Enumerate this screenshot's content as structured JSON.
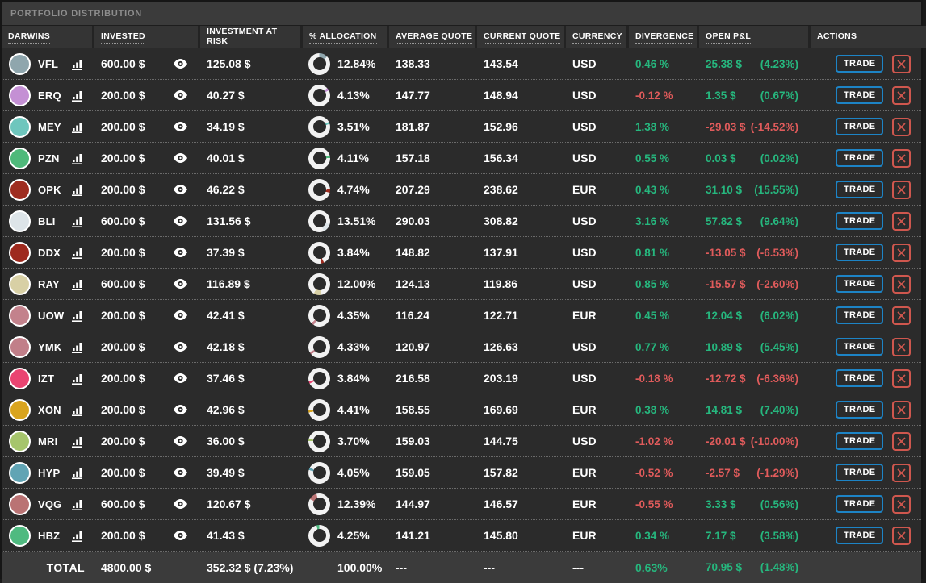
{
  "title": "PORTFOLIO DISTRIBUTION",
  "columns": [
    "DARWINS",
    "INVESTED",
    "INVESTMENT AT RISK",
    "% ALLOCATION",
    "AVERAGE QUOTE",
    "CURRENT QUOTE",
    "CURRENCY",
    "DIVERGENCE",
    "OPEN P&L",
    "ACTIONS"
  ],
  "actions": {
    "trade_label": "TRADE",
    "close_icon": "x-icon"
  },
  "colors": {
    "green": "#26b77e",
    "red": "#e05b5b",
    "trade_border_blue": "#1d84c6",
    "close_border_red": "#cf574e",
    "donut_ring": "#f2f2f2",
    "row_bg": "#2b2b2b",
    "header_bg": "#343434",
    "titlebar_bg": "#3b3b3b",
    "total_bg": "#3b3b3b"
  },
  "rows": [
    {
      "name": "VFL",
      "color": "#8fa6ad",
      "invested": "600.00 $",
      "at_risk": "125.08 $",
      "allocation_pct": 12.84,
      "allocation": "12.84%",
      "avg_quote": "138.33",
      "current_quote": "143.54",
      "currency": "USD",
      "divergence": "0.46 %",
      "divergence_state": "pos",
      "pnl": "25.38 $",
      "pnl_pct": "(4.23%)",
      "pnl_state": "pos"
    },
    {
      "name": "ERQ",
      "color": "#c490d4",
      "invested": "200.00 $",
      "at_risk": "40.27 $",
      "allocation_pct": 4.13,
      "allocation": "4.13%",
      "avg_quote": "147.77",
      "current_quote": "148.94",
      "currency": "USD",
      "divergence": "-0.12 %",
      "divergence_state": "neg",
      "pnl": "1.35 $",
      "pnl_pct": "(0.67%)",
      "pnl_state": "pos"
    },
    {
      "name": "MEY",
      "color": "#6ec6bd",
      "invested": "200.00 $",
      "at_risk": "34.19 $",
      "allocation_pct": 3.51,
      "allocation": "3.51%",
      "avg_quote": "181.87",
      "current_quote": "152.96",
      "currency": "USD",
      "divergence": "1.38 %",
      "divergence_state": "pos",
      "pnl": "-29.03 $",
      "pnl_pct": "(-14.52%)",
      "pnl_state": "neg"
    },
    {
      "name": "PZN",
      "color": "#4eb97a",
      "invested": "200.00 $",
      "at_risk": "40.01 $",
      "allocation_pct": 4.11,
      "allocation": "4.11%",
      "avg_quote": "157.18",
      "current_quote": "156.34",
      "currency": "USD",
      "divergence": "0.55 %",
      "divergence_state": "pos",
      "pnl": "0.03 $",
      "pnl_pct": "(0.02%)",
      "pnl_state": "pos"
    },
    {
      "name": "OPK",
      "color": "#9e2d20",
      "invested": "200.00 $",
      "at_risk": "46.22 $",
      "allocation_pct": 4.74,
      "allocation": "4.74%",
      "avg_quote": "207.29",
      "current_quote": "238.62",
      "currency": "EUR",
      "divergence": "0.43 %",
      "divergence_state": "pos",
      "pnl": "31.10 $",
      "pnl_pct": "(15.55%)",
      "pnl_state": "pos"
    },
    {
      "name": "BLI",
      "color": "#dde4e8",
      "invested": "600.00 $",
      "at_risk": "131.56 $",
      "allocation_pct": 13.51,
      "allocation": "13.51%",
      "avg_quote": "290.03",
      "current_quote": "308.82",
      "currency": "USD",
      "divergence": "3.16 %",
      "divergence_state": "pos",
      "pnl": "57.82 $",
      "pnl_pct": "(9.64%)",
      "pnl_state": "pos"
    },
    {
      "name": "DDX",
      "color": "#9e2a1e",
      "invested": "200.00 $",
      "at_risk": "37.39 $",
      "allocation_pct": 3.84,
      "allocation": "3.84%",
      "avg_quote": "148.82",
      "current_quote": "137.91",
      "currency": "USD",
      "divergence": "0.81 %",
      "divergence_state": "pos",
      "pnl": "-13.05 $",
      "pnl_pct": "(-6.53%)",
      "pnl_state": "neg"
    },
    {
      "name": "RAY",
      "color": "#d8d0a5",
      "invested": "600.00 $",
      "at_risk": "116.89 $",
      "allocation_pct": 12.0,
      "allocation": "12.00%",
      "avg_quote": "124.13",
      "current_quote": "119.86",
      "currency": "USD",
      "divergence": "0.85 %",
      "divergence_state": "pos",
      "pnl": "-15.57 $",
      "pnl_pct": "(-2.60%)",
      "pnl_state": "neg"
    },
    {
      "name": "UOW",
      "color": "#c3828c",
      "invested": "200.00 $",
      "at_risk": "42.41 $",
      "allocation_pct": 4.35,
      "allocation": "4.35%",
      "avg_quote": "116.24",
      "current_quote": "122.71",
      "currency": "EUR",
      "divergence": "0.45 %",
      "divergence_state": "pos",
      "pnl": "12.04 $",
      "pnl_pct": "(6.02%)",
      "pnl_state": "pos"
    },
    {
      "name": "YMK",
      "color": "#c17f89",
      "invested": "200.00 $",
      "at_risk": "42.18 $",
      "allocation_pct": 4.33,
      "allocation": "4.33%",
      "avg_quote": "120.97",
      "current_quote": "126.63",
      "currency": "USD",
      "divergence": "0.77 %",
      "divergence_state": "pos",
      "pnl": "10.89 $",
      "pnl_pct": "(5.45%)",
      "pnl_state": "pos"
    },
    {
      "name": "IZT",
      "color": "#ea4471",
      "invested": "200.00 $",
      "at_risk": "37.46 $",
      "allocation_pct": 3.84,
      "allocation": "3.84%",
      "avg_quote": "216.58",
      "current_quote": "203.19",
      "currency": "USD",
      "divergence": "-0.18 %",
      "divergence_state": "neg",
      "pnl": "-12.72 $",
      "pnl_pct": "(-6.36%)",
      "pnl_state": "neg"
    },
    {
      "name": "XON",
      "color": "#d9a41f",
      "invested": "200.00 $",
      "at_risk": "42.96 $",
      "allocation_pct": 4.41,
      "allocation": "4.41%",
      "avg_quote": "158.55",
      "current_quote": "169.69",
      "currency": "EUR",
      "divergence": "0.38 %",
      "divergence_state": "pos",
      "pnl": "14.81 $",
      "pnl_pct": "(7.40%)",
      "pnl_state": "pos"
    },
    {
      "name": "MRI",
      "color": "#a6c56c",
      "invested": "200.00 $",
      "at_risk": "36.00 $",
      "allocation_pct": 3.7,
      "allocation": "3.70%",
      "avg_quote": "159.03",
      "current_quote": "144.75",
      "currency": "USD",
      "divergence": "-1.02 %",
      "divergence_state": "neg",
      "pnl": "-20.01 $",
      "pnl_pct": "(-10.00%)",
      "pnl_state": "neg"
    },
    {
      "name": "HYP",
      "color": "#61a4b4",
      "invested": "200.00 $",
      "at_risk": "39.49 $",
      "allocation_pct": 4.05,
      "allocation": "4.05%",
      "avg_quote": "159.05",
      "current_quote": "157.82",
      "currency": "EUR",
      "divergence": "-0.52 %",
      "divergence_state": "neg",
      "pnl": "-2.57 $",
      "pnl_pct": "(-1.29%)",
      "pnl_state": "neg"
    },
    {
      "name": "VQG",
      "color": "#ba7374",
      "invested": "600.00 $",
      "at_risk": "120.67 $",
      "allocation_pct": 12.39,
      "allocation": "12.39%",
      "avg_quote": "144.97",
      "current_quote": "146.57",
      "currency": "EUR",
      "divergence": "-0.55 %",
      "divergence_state": "neg",
      "pnl": "3.33 $",
      "pnl_pct": "(0.56%)",
      "pnl_state": "pos"
    },
    {
      "name": "HBZ",
      "color": "#4fba80",
      "invested": "200.00 $",
      "at_risk": "41.43 $",
      "allocation_pct": 4.25,
      "allocation": "4.25%",
      "avg_quote": "141.21",
      "current_quote": "145.80",
      "currency": "EUR",
      "divergence": "0.34 %",
      "divergence_state": "pos",
      "pnl": "7.17 $",
      "pnl_pct": "(3.58%)",
      "pnl_state": "pos"
    }
  ],
  "total": {
    "label": "TOTAL",
    "invested": "4800.00 $",
    "at_risk": "352.32 $ (7.23%)",
    "allocation": "100.00%",
    "avg_quote": "---",
    "current_quote": "---",
    "currency": "---",
    "divergence": "0.63%",
    "divergence_state": "pos",
    "pnl": "70.95 $",
    "pnl_pct": "(1.48%)",
    "pnl_state": "pos"
  }
}
